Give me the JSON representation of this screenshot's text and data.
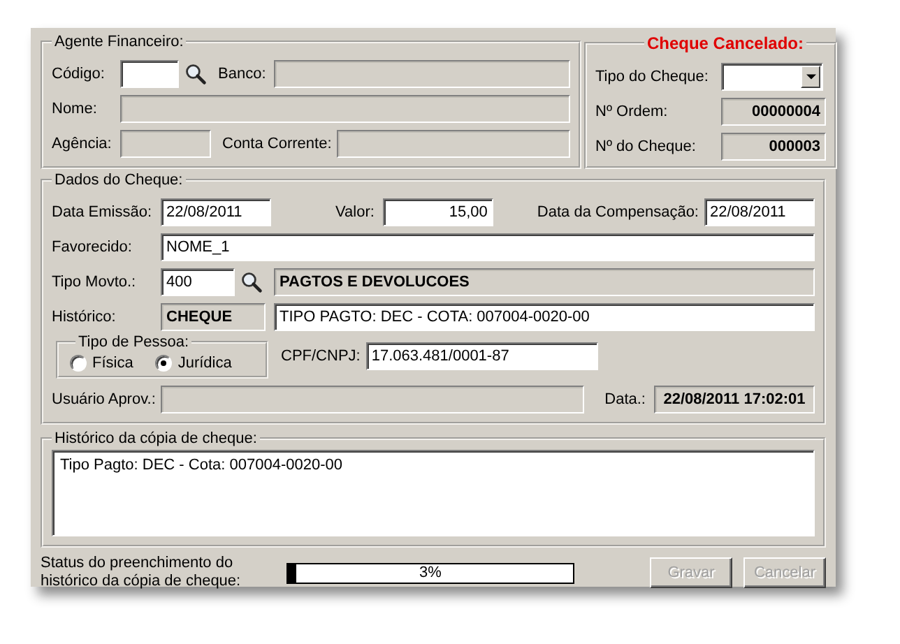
{
  "agente_financeiro": {
    "title": "Agente Financeiro:",
    "codigo": {
      "label": "Código:",
      "disabled": false
    },
    "banco": {
      "label": "Banco:",
      "disabled": true
    },
    "nome": {
      "label": "Nome:",
      "disabled": true
    },
    "agencia": {
      "label": "Agência:",
      "disabled": true
    },
    "conta_corrente": {
      "label": "Conta Corrente:",
      "disabled": true
    }
  },
  "cheque": {
    "title": "Cheque Cancelado:",
    "tipo_do_cheque": {
      "label": "Tipo do Cheque:",
      "disabled": false
    },
    "numero_ordem": {
      "label": "Nº Ordem:",
      "value": "00000004",
      "disabled": true
    },
    "numero_cheque": {
      "label": "Nº do Cheque:",
      "value": "000003",
      "disabled": true
    }
  },
  "dados_do_cheque": {
    "title": "Dados do Cheque:",
    "data_emissao": {
      "label": "Data Emissão:",
      "value": "22/08/2011",
      "disabled": false
    },
    "valor": {
      "label": "Valor:",
      "value": "15,00",
      "disabled": false
    },
    "data_compensacao": {
      "label": "Data da Compensação:",
      "value": "22/08/2011",
      "disabled": false
    },
    "favorecido": {
      "label": "Favorecido:",
      "value": "NOME_1",
      "disabled": false
    },
    "tipo_movto": {
      "label": "Tipo Movto.:",
      "value": "400",
      "disabled": false
    },
    "tipo_movto_descricao": {
      "value": "PAGTOS E DEVOLUCOES",
      "disabled": true
    },
    "historico_codigo": {
      "label": "Histórico:",
      "value": "CHEQUE",
      "disabled": true
    },
    "historico": {
      "value": "TIPO PAGTO: DEC - COTA: 007004-0020-00",
      "disabled": false
    },
    "tipo_pessoa": {
      "title": "Tipo de Pessoa:",
      "options": [
        {
          "label": "Física",
          "selected": false
        },
        {
          "label": "Jurídica",
          "selected": true
        }
      ]
    },
    "cpf_cnpj": {
      "label": "CPF/CNPJ:",
      "value": "17.063.481/0001-87",
      "disabled": false
    },
    "usuario_aprov": {
      "label": "Usuário Aprov.:",
      "disabled": true
    },
    "data": {
      "label": "Data.:",
      "value": "22/08/2011 17:02:01",
      "disabled": true
    }
  },
  "historico_copia": {
    "title": "Histórico da cópia de cheque:",
    "text": "Tipo Pagto: DEC - Cota: 007004-0020-00"
  },
  "status": {
    "label": "Status do preenchimento do histórico da cópia de cheque:",
    "level": 0.03,
    "reading": "3%"
  },
  "buttons": [
    {
      "label": "Gravar",
      "disabled": true
    },
    {
      "label": "Cancelar",
      "disabled": true
    }
  ]
}
